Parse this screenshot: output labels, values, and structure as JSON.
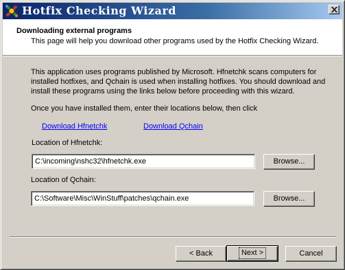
{
  "window": {
    "title": "Hotfix Checking Wizard",
    "close_symbol": "✕"
  },
  "header": {
    "title": "Downloading external programs",
    "subtitle": "This page will help you download other programs used by the Hotfix Checking Wizard."
  },
  "body": {
    "paragraph": "This application uses programs published by Microsoft.  Hfnetchk scans computers for installed hotfixes, and Qchain is used when installing hotfixes.  You should download and install these programs using the links below before proceeding with this wizard.",
    "instruction": "Once you have installed them, enter their locations below, then click"
  },
  "links": {
    "hfnetchk": "Download Hfnetchk",
    "qchain": "Download Qchain"
  },
  "fields": {
    "hfnetchk": {
      "label": "Location of Hfnetchk:",
      "value": "C:\\incoming\\nshc32\\hfnetchk.exe",
      "browse_label": "Browse..."
    },
    "qchain": {
      "label": "Location of Qchain:",
      "value": "C:\\Software\\Misc\\WinStuff\\patches\\qchain.exe",
      "browse_label": "Browse..."
    }
  },
  "footer": {
    "back_label": "< Back",
    "next_label": "Next >",
    "cancel_label": "Cancel"
  },
  "colors": {
    "title_gradient_start": "#0a246a",
    "title_gradient_end": "#a6caf0",
    "link": "#0000ff",
    "face": "#d4d0c8"
  }
}
